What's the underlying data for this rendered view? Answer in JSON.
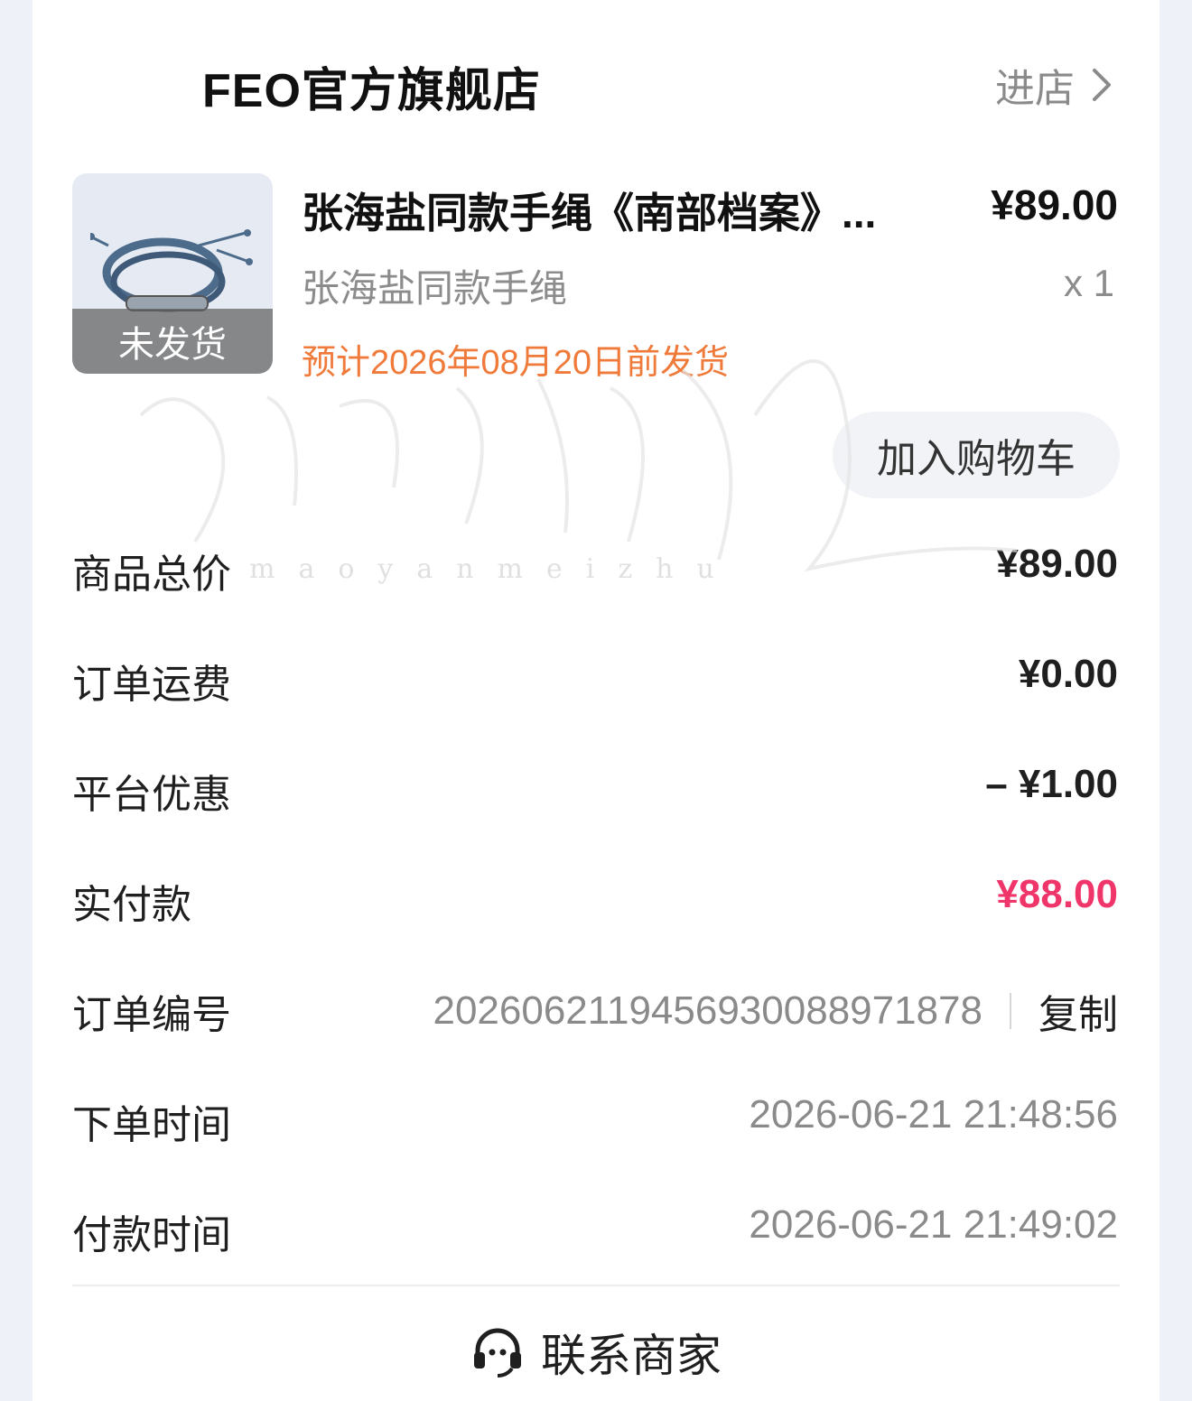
{
  "shop": {
    "name": "FEO官方旗舰店",
    "enter_label": "进店"
  },
  "product": {
    "title": "张海盐同款手绳《南部档案》...",
    "price": "¥89.00",
    "spec": "张海盐同款手绳",
    "quantity": "x 1",
    "status_badge": "未发货",
    "shipping_estimate": "预计2026年08月20日前发货",
    "add_to_cart_label": "加入购物车"
  },
  "summary": {
    "total": {
      "label": "商品总价",
      "value": "¥89.00"
    },
    "shipping": {
      "label": "订单运费",
      "value": "¥0.00"
    },
    "discount": {
      "label": "平台优惠",
      "value": "– ¥1.00"
    },
    "paid": {
      "label": "实付款",
      "value": "¥88.00"
    }
  },
  "order": {
    "number_label": "订单编号",
    "number": "2026062119456930088971878",
    "copy_label": "复制",
    "placed_label": "下单时间",
    "placed_time": "2026-06-21 21:48:56",
    "paid_label": "付款时间",
    "paid_time": "2026-06-21 21:49:02"
  },
  "contact": {
    "label": "联系商家"
  },
  "colors": {
    "accent_pink": "#f0356a",
    "ship_orange": "#f07a3a",
    "muted": "#8a8a8a"
  },
  "watermark": {
    "text": "maoyanmeizhu"
  }
}
